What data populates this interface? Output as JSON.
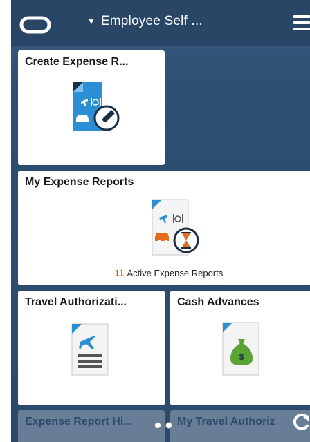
{
  "header": {
    "title": "Employee Self ...",
    "caret_icon": "caret-down-icon",
    "logo_icon": "oracle-logo-icon",
    "menu_icon": "hamburger-menu-icon"
  },
  "tiles": {
    "create_expense": {
      "title": "Create Expense R..."
    },
    "my_expense_reports": {
      "title": "My Expense Reports",
      "count": "11",
      "count_label": "Active Expense Reports"
    },
    "travel_authorization": {
      "title": "Travel Authorizati..."
    },
    "cash_advances": {
      "title": "Cash Advances"
    },
    "expense_history": {
      "title": "Expense Report Hi..."
    },
    "my_travel_auth": {
      "title": "My Travel Authoriz"
    }
  },
  "colors": {
    "accent_blue": "#2b8fd6",
    "accent_orange": "#e56a1a",
    "money_green": "#5aa335",
    "header_bg": "#2a4666",
    "count_color": "#d15a12"
  }
}
